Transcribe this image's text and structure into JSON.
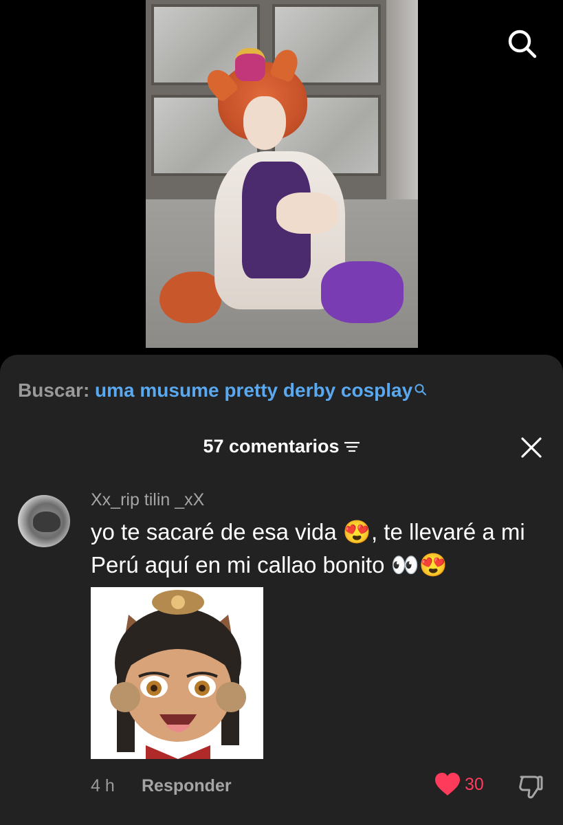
{
  "search_bar": {
    "prefix": "Buscar:",
    "query": "uma musume pretty derby cosplay"
  },
  "comments": {
    "header": "57 comentarios"
  },
  "comment": {
    "username": "Xx_rip tilin _xX",
    "text": "yo te sacaré de esa vida 😍, te llevaré a mi Perú aquí en mi callao bonito 👀😍",
    "time": "4 h",
    "reply_label": "Responder",
    "likes": "30"
  },
  "colors": {
    "sheet_background": "#222222",
    "link_blue": "#5aa9f0",
    "like_red": "#ff3b5c"
  },
  "icons": [
    "search-icon",
    "sort-icon",
    "close-icon",
    "heart-icon",
    "dislike-icon"
  ]
}
